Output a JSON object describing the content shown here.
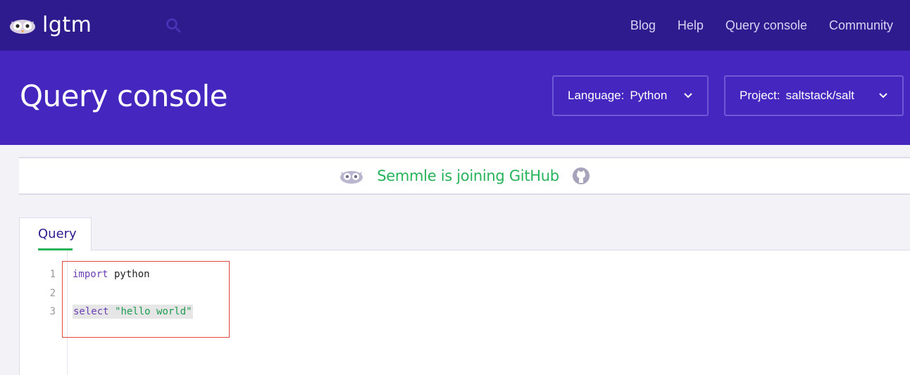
{
  "brand": {
    "name": "lgtm"
  },
  "nav": {
    "items": [
      "Blog",
      "Help",
      "Query console",
      "Community"
    ]
  },
  "header": {
    "title": "Query console",
    "language": {
      "label": "Language:",
      "value": "Python"
    },
    "project": {
      "label": "Project:",
      "value": "saltstack/salt"
    }
  },
  "announcement": {
    "text": "Semmle is joining GitHub"
  },
  "tabs": [
    {
      "label": "Query",
      "active": true
    }
  ],
  "editor": {
    "lines": [
      {
        "number": "1",
        "keyword": "import",
        "rest": " python"
      },
      {
        "number": "2",
        "keyword": "",
        "rest": ""
      },
      {
        "number": "3",
        "keyword": "select",
        "string": "\"hello world\""
      }
    ]
  },
  "colors": {
    "nav_bg": "#2e1c8f",
    "header_bg": "#4527c0",
    "accent_green": "#27b35a",
    "keyword": "#6a3fb5",
    "string": "#1d9b4e",
    "annotation_red": "#e0463c"
  },
  "icons": {
    "logo": "owl-icon",
    "search": "search-icon",
    "chevron": "chevron-down-icon",
    "announce_mascot": "owl-icon",
    "github": "github-icon"
  }
}
